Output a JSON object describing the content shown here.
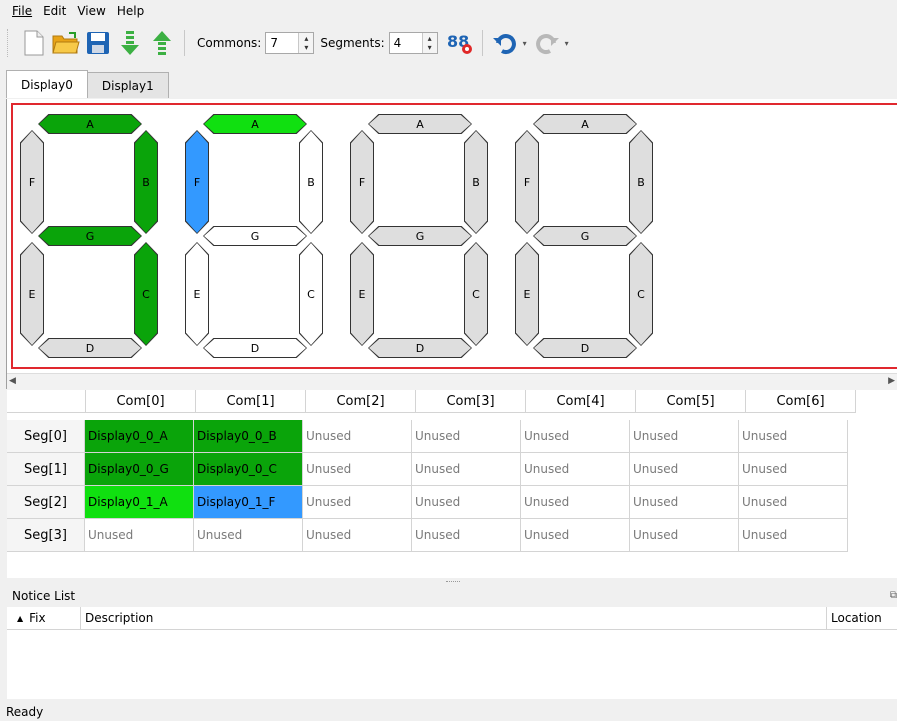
{
  "menu": [
    "File",
    "Edit",
    "View",
    "Help"
  ],
  "toolbar": {
    "commons_label": "Commons:",
    "commons_value": "7",
    "segments_label": "Segments:",
    "segments_value": "4"
  },
  "tabs": [
    "Display0",
    "Display1"
  ],
  "digits": [
    {
      "A": "A",
      "B": "B",
      "C": "C",
      "D": "D",
      "E": "E",
      "F": "F",
      "G": "G"
    },
    {
      "A": "A",
      "B": "B",
      "C": "C",
      "D": "D",
      "E": "E",
      "F": "F",
      "G": "G"
    },
    {
      "A": "A",
      "B": "B",
      "C": "C",
      "D": "D",
      "E": "E",
      "F": "F",
      "G": "G"
    },
    {
      "A": "A",
      "B": "B",
      "C": "C",
      "D": "D",
      "E": "E",
      "F": "F",
      "G": "G"
    }
  ],
  "grid": {
    "columns": [
      "Com[0]",
      "Com[1]",
      "Com[2]",
      "Com[3]",
      "Com[4]",
      "Com[5]",
      "Com[6]"
    ],
    "rows": [
      {
        "label": "Seg[0]",
        "cells": [
          "Display0_0_A",
          "Display0_0_B",
          "Unused",
          "Unused",
          "Unused",
          "Unused",
          "Unused"
        ]
      },
      {
        "label": "Seg[1]",
        "cells": [
          "Display0_0_G",
          "Display0_0_C",
          "Unused",
          "Unused",
          "Unused",
          "Unused",
          "Unused"
        ]
      },
      {
        "label": "Seg[2]",
        "cells": [
          "Display0_1_A",
          "Display0_1_F",
          "Unused",
          "Unused",
          "Unused",
          "Unused",
          "Unused"
        ]
      },
      {
        "label": "Seg[3]",
        "cells": [
          "Unused",
          "Unused",
          "Unused",
          "Unused",
          "Unused",
          "Unused",
          "Unused"
        ]
      }
    ]
  },
  "notice": {
    "title": "Notice List",
    "col_fix": "Fix",
    "col_description": "Description",
    "col_location": "Location"
  },
  "status": "Ready",
  "colors": {
    "assigned_dark": "#0aa40a",
    "assigned_light": "#10e010",
    "assigned_blue": "#3399ff",
    "highlight_border": "#e0282e"
  }
}
